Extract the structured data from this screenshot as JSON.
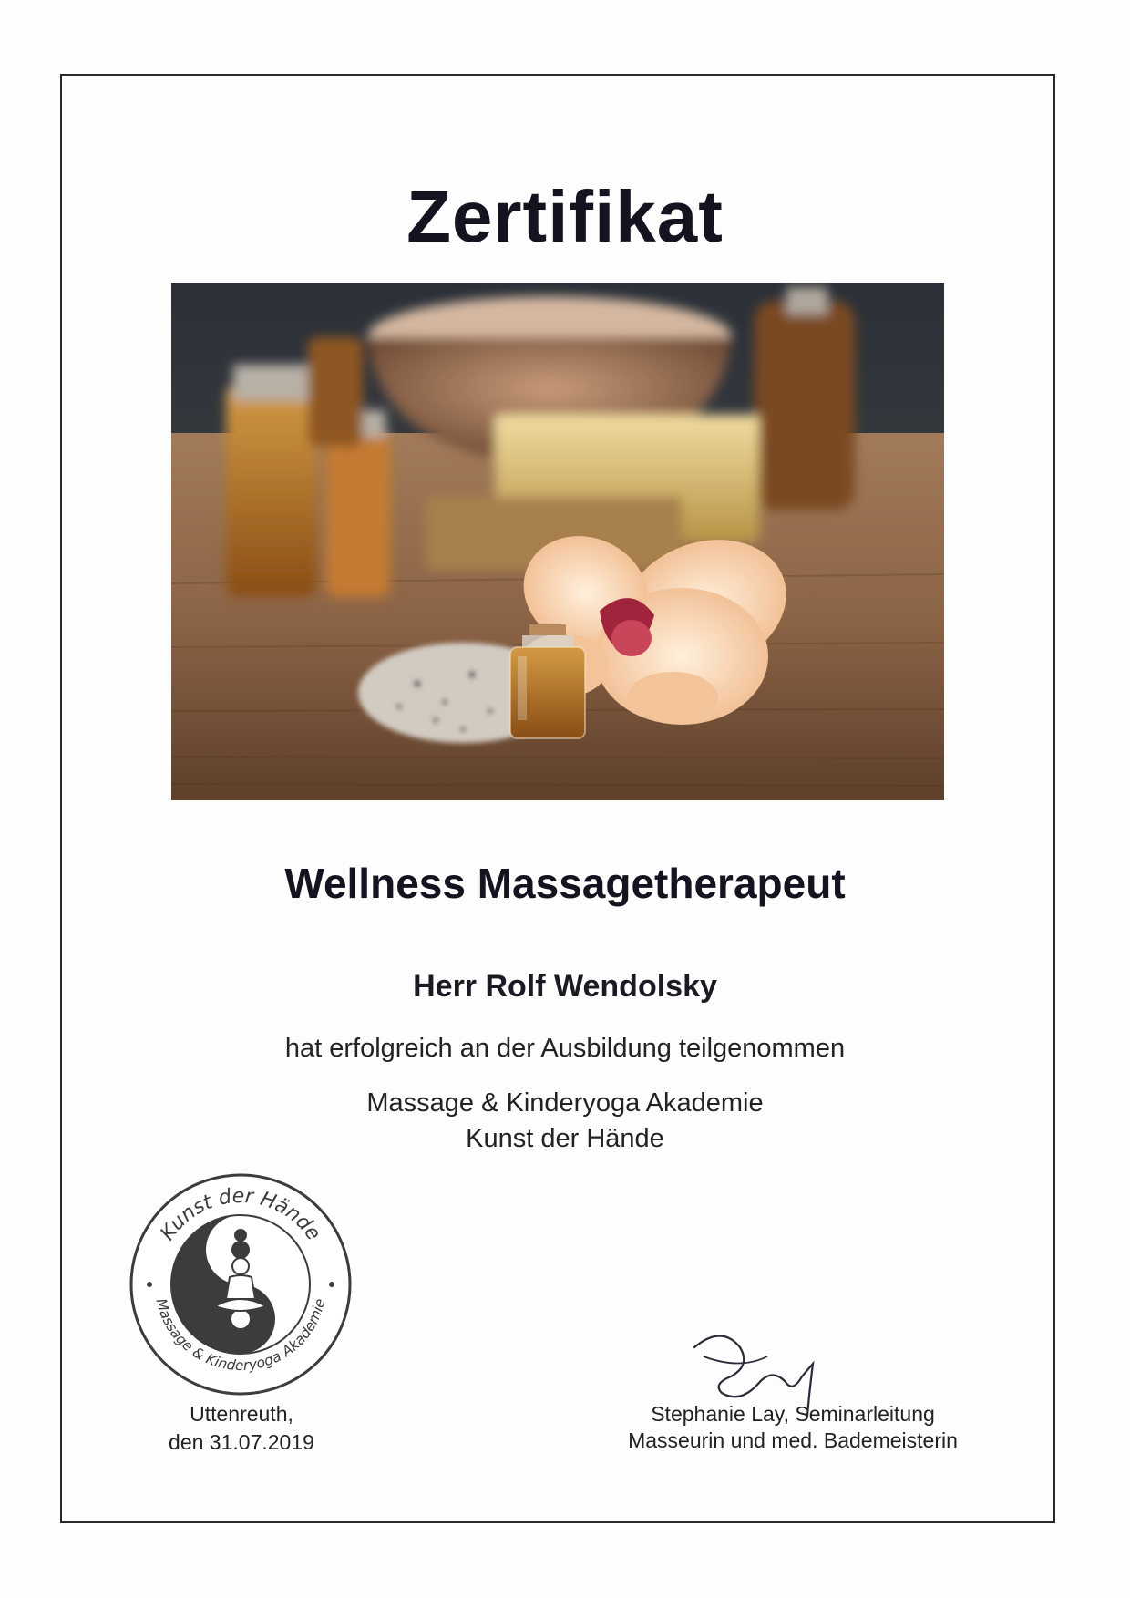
{
  "certificate": {
    "title": "Zertifikat",
    "course": "Wellness Massagetherapeut",
    "recipient": "Herr Rolf Wendolsky",
    "statement": "hat erfolgreich an der Ausbildung teilgenommen",
    "academy_line1": "Massage & Kinderyoga Akademie",
    "academy_line2": "Kunst der Hände",
    "place": "Uttenreuth,",
    "date": "den 31.07.2019",
    "signer_line1": "Stephanie Lay, Seminarleitung",
    "signer_line2": "Masseurin und med. Bademeisterin"
  },
  "seal": {
    "top_text": "Kunst der Hände",
    "bottom_text": "Massage & Kinderyoga Akademie",
    "icon": "yin-yang-meditation-icon"
  },
  "photo": {
    "subject": "spa-oils-orchid-photo"
  },
  "colors": {
    "text": "#141420",
    "frame": "#2a2a2a",
    "seal": "#3c3c3c"
  }
}
